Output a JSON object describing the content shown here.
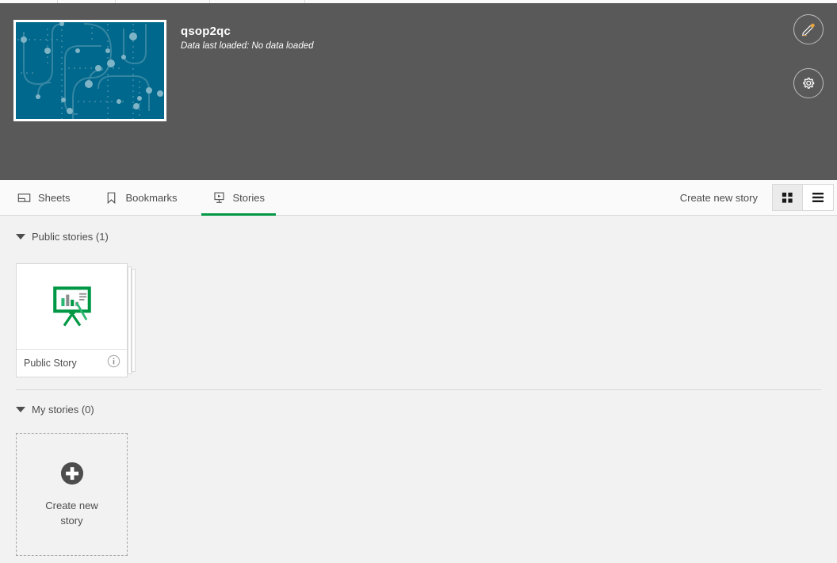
{
  "header": {
    "app_title": "qsop2qc",
    "data_status": "Data last loaded: No data loaded",
    "thumbnail_color": "#00688c",
    "background_color": "#595959",
    "edit_button_label": "Edit app",
    "settings_button_label": "App settings"
  },
  "tabs": [
    {
      "id": "sheets",
      "label": "Sheets",
      "icon": "sheet-icon",
      "active": false
    },
    {
      "id": "bookmarks",
      "label": "Bookmarks",
      "icon": "bookmark-icon",
      "active": false
    },
    {
      "id": "stories",
      "label": "Stories",
      "icon": "story-icon",
      "active": true
    }
  ],
  "toolbar": {
    "create_new_story": "Create new story",
    "grid_view_label": "Grid view",
    "list_view_label": "List view",
    "selected_view": "grid"
  },
  "sections": [
    {
      "id": "public-stories",
      "title": "Public stories (1)",
      "expanded": true,
      "items": [
        {
          "name": "Public Story",
          "icon": "story-easel-icon",
          "info_label": "Show details"
        }
      ]
    },
    {
      "id": "my-stories",
      "title": "My stories (0)",
      "expanded": true,
      "items": []
    }
  ],
  "create_tile": {
    "label": "Create new story",
    "icon": "plus-circle-icon"
  },
  "colors": {
    "accent_green": "#009845",
    "header_grey": "#595959",
    "content_bg": "#f2f2f2",
    "teal": "#00688c",
    "text": "#4d4d4d"
  }
}
